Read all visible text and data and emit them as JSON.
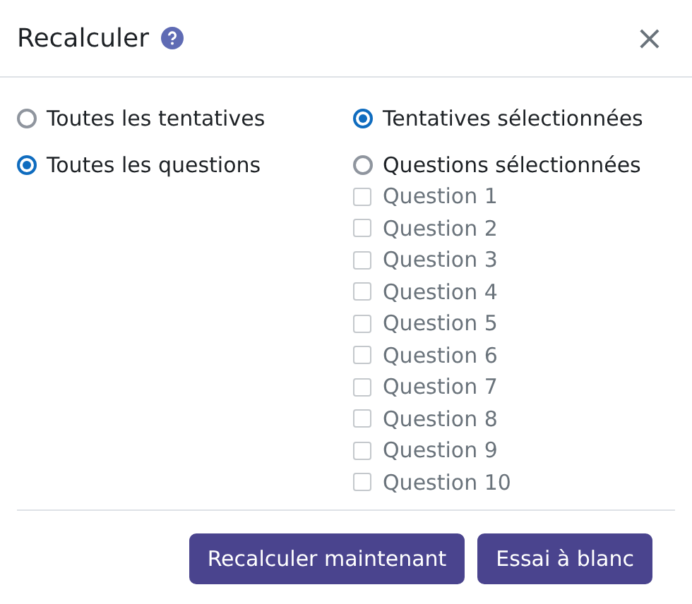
{
  "dialog": {
    "title": "Recalculer",
    "close": "×"
  },
  "attempts": [
    {
      "label": "Toutes les tentatives",
      "selected": false
    },
    {
      "label": "Tentatives sélectionnées",
      "selected": true
    }
  ],
  "question_scope": [
    {
      "label": "Toutes les questions",
      "selected": true
    },
    {
      "label": "Questions sélectionnées",
      "selected": false
    }
  ],
  "questions": [
    {
      "label": "Question 1",
      "checked": false,
      "disabled": true
    },
    {
      "label": "Question 2",
      "checked": false,
      "disabled": true
    },
    {
      "label": "Question 3",
      "checked": false,
      "disabled": true
    },
    {
      "label": "Question 4",
      "checked": false,
      "disabled": true
    },
    {
      "label": "Question 5",
      "checked": false,
      "disabled": true
    },
    {
      "label": "Question 6",
      "checked": false,
      "disabled": true
    },
    {
      "label": "Question 7",
      "checked": false,
      "disabled": true
    },
    {
      "label": "Question 8",
      "checked": false,
      "disabled": true
    },
    {
      "label": "Question 9",
      "checked": false,
      "disabled": true
    },
    {
      "label": "Question 10",
      "checked": false,
      "disabled": true
    }
  ],
  "buttons": [
    "Recalculer maintenant",
    "Essai à blanc"
  ]
}
